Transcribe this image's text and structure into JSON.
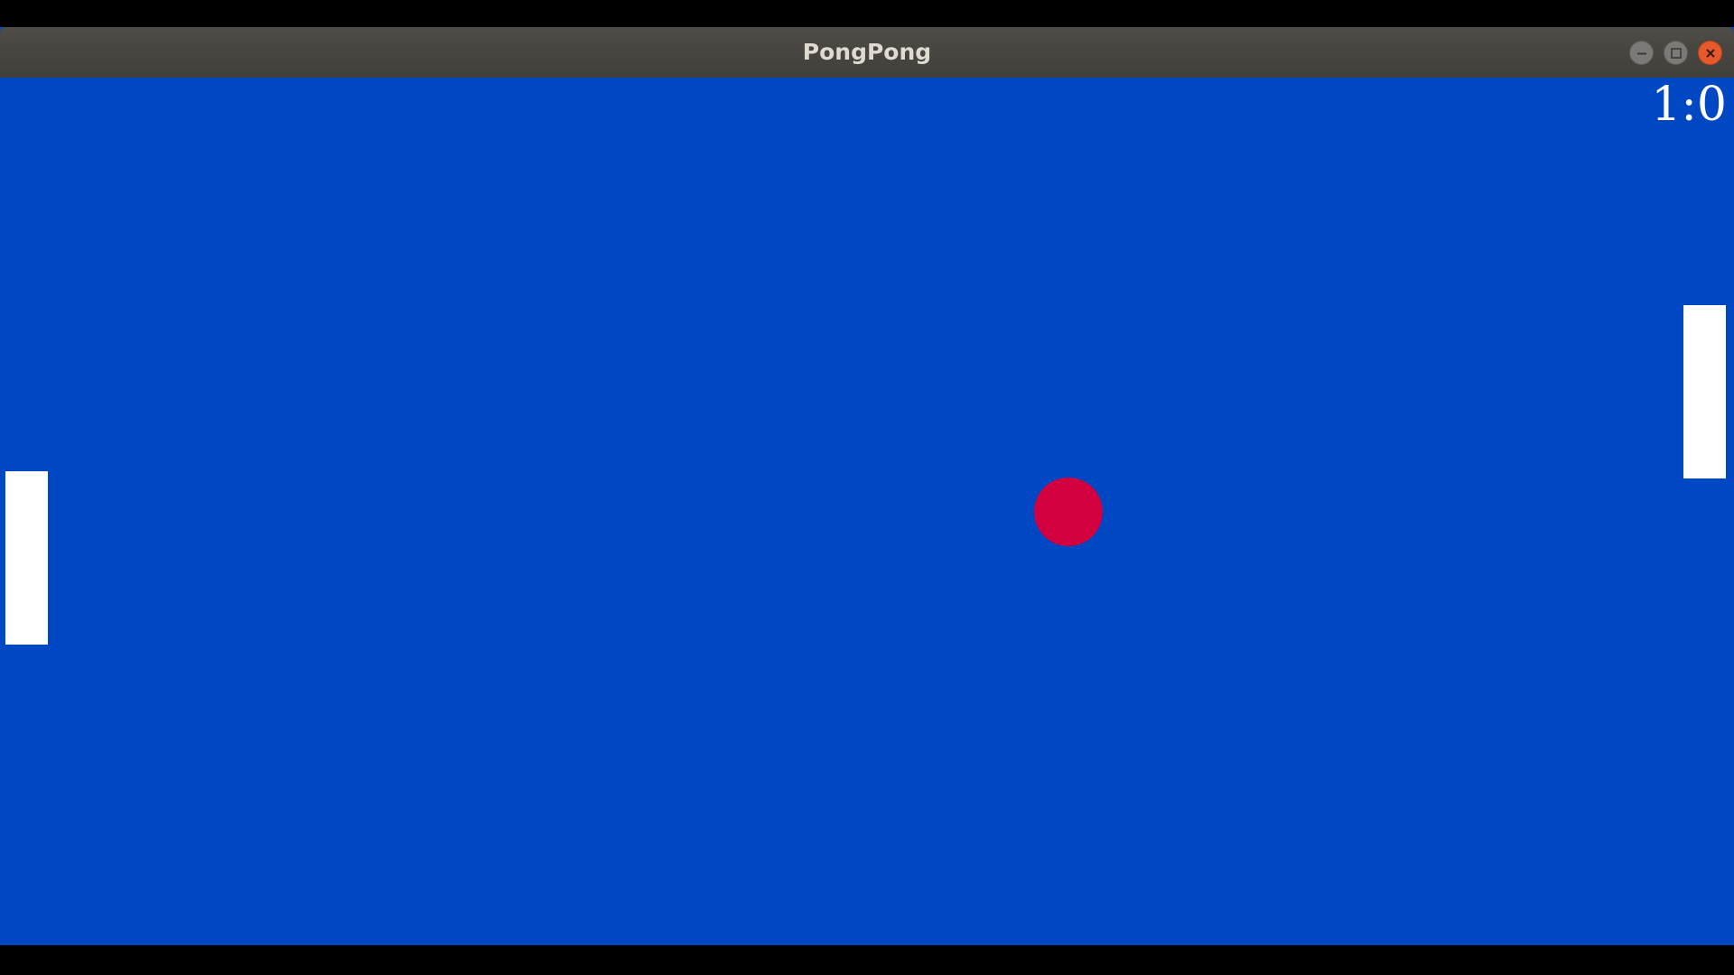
{
  "window": {
    "title": "PongPong",
    "controls": {
      "minimize_icon": "minimize-icon",
      "maximize_icon": "maximize-icon",
      "close_icon": "close-icon"
    }
  },
  "game": {
    "score": "1:0",
    "colors": {
      "background": "#0047c3",
      "paddle": "#ffffff",
      "ball": "#d2003f",
      "score_text": "#ffffff"
    }
  }
}
